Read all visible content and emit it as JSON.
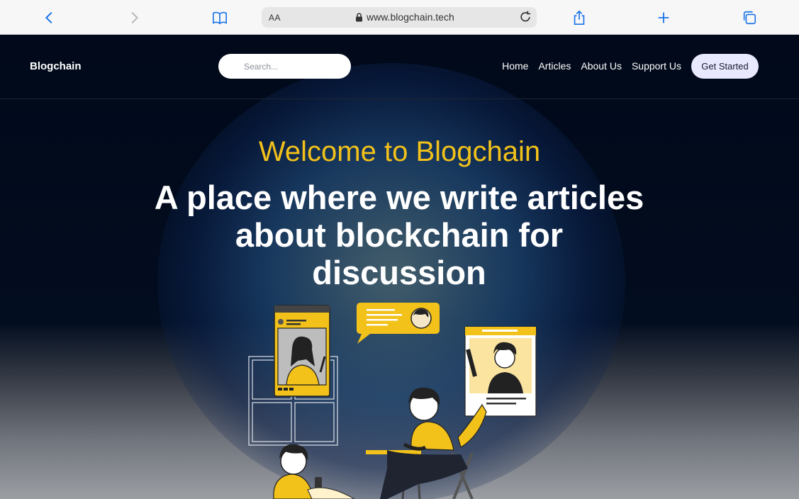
{
  "browser": {
    "text_size_label": "AA",
    "url": "www.blogchain.tech"
  },
  "site": {
    "logo": "Blogchain",
    "search_placeholder": "Search...",
    "nav": [
      "Home",
      "Articles",
      "About Us",
      "Support Us"
    ],
    "cta_label": "Get Started"
  },
  "hero": {
    "welcome": "Welcome to Blogchain",
    "headline": "A place where we write articles about blockchain for discussion"
  },
  "colors": {
    "accent": "#f2c11a",
    "background": "#01091a",
    "cta_bg": "#e8e9ff"
  }
}
